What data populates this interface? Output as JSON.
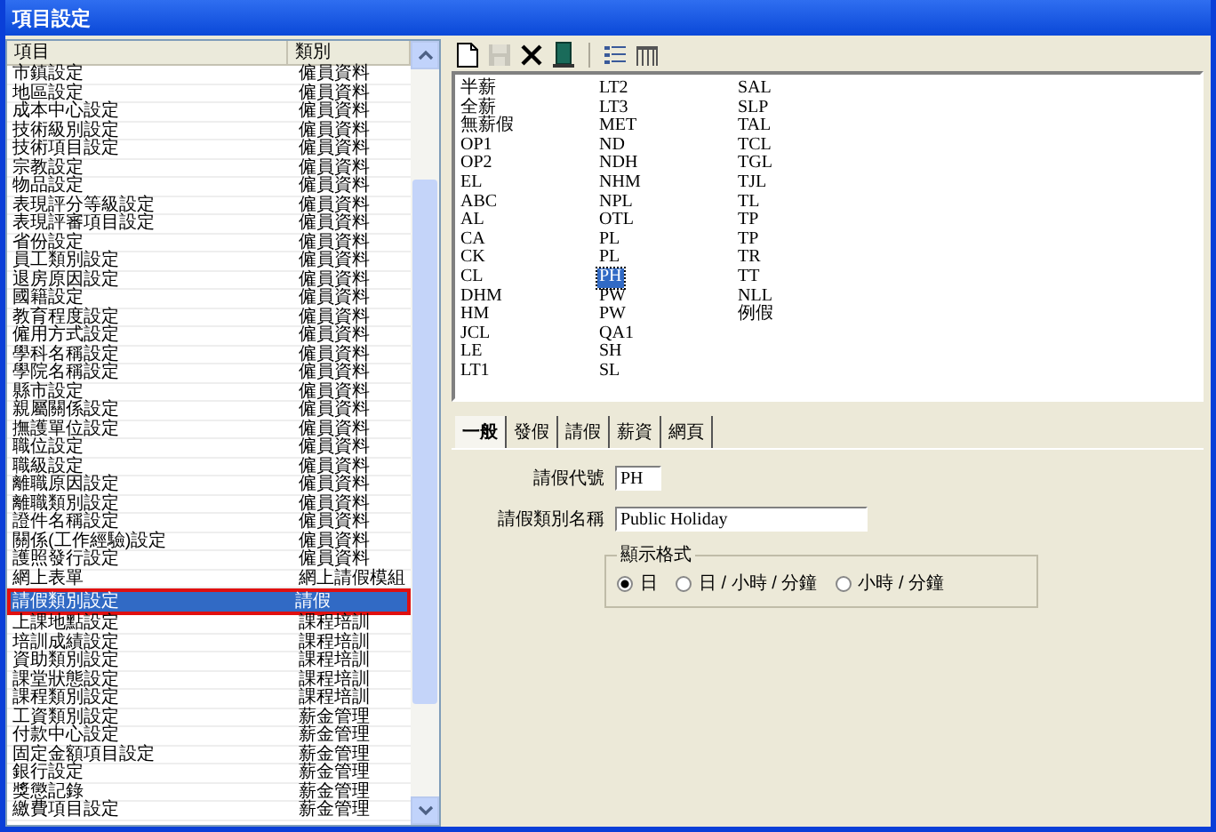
{
  "window": {
    "title": "項目設定"
  },
  "list": {
    "columns": [
      "項目",
      "類別"
    ],
    "rows": [
      {
        "item": "市鎮設定",
        "category": "僱員資料",
        "selected": false,
        "marked": false
      },
      {
        "item": "地區設定",
        "category": "僱員資料",
        "selected": false,
        "marked": false
      },
      {
        "item": "成本中心設定",
        "category": "僱員資料",
        "selected": false,
        "marked": false
      },
      {
        "item": "技術級別設定",
        "category": "僱員資料",
        "selected": false,
        "marked": false
      },
      {
        "item": "技術項目設定",
        "category": "僱員資料",
        "selected": false,
        "marked": false
      },
      {
        "item": "宗教設定",
        "category": "僱員資料",
        "selected": false,
        "marked": false
      },
      {
        "item": "物品設定",
        "category": "僱員資料",
        "selected": false,
        "marked": false
      },
      {
        "item": "表現評分等級設定",
        "category": "僱員資料",
        "selected": false,
        "marked": false
      },
      {
        "item": "表現評審項目設定",
        "category": "僱員資料",
        "selected": false,
        "marked": false
      },
      {
        "item": "省份設定",
        "category": "僱員資料",
        "selected": false,
        "marked": false
      },
      {
        "item": "員工類別設定",
        "category": "僱員資料",
        "selected": false,
        "marked": false
      },
      {
        "item": "退房原因設定",
        "category": "僱員資料",
        "selected": false,
        "marked": false
      },
      {
        "item": "國籍設定",
        "category": "僱員資料",
        "selected": false,
        "marked": false
      },
      {
        "item": "教育程度設定",
        "category": "僱員資料",
        "selected": false,
        "marked": false
      },
      {
        "item": "僱用方式設定",
        "category": "僱員資料",
        "selected": false,
        "marked": false
      },
      {
        "item": "學科名稱設定",
        "category": "僱員資料",
        "selected": false,
        "marked": false
      },
      {
        "item": "學院名稱設定",
        "category": "僱員資料",
        "selected": false,
        "marked": false
      },
      {
        "item": "縣市設定",
        "category": "僱員資料",
        "selected": false,
        "marked": false
      },
      {
        "item": "親屬關係設定",
        "category": "僱員資料",
        "selected": false,
        "marked": false
      },
      {
        "item": "撫護單位設定",
        "category": "僱員資料",
        "selected": false,
        "marked": false
      },
      {
        "item": "職位設定",
        "category": "僱員資料",
        "selected": false,
        "marked": false
      },
      {
        "item": "職級設定",
        "category": "僱員資料",
        "selected": false,
        "marked": false
      },
      {
        "item": "離職原因設定",
        "category": "僱員資料",
        "selected": false,
        "marked": false
      },
      {
        "item": "離職類別設定",
        "category": "僱員資料",
        "selected": false,
        "marked": false
      },
      {
        "item": "證件名稱設定",
        "category": "僱員資料",
        "selected": false,
        "marked": false
      },
      {
        "item": "關係(工作經驗)設定",
        "category": "僱員資料",
        "selected": false,
        "marked": false
      },
      {
        "item": "護照發行設定",
        "category": "僱員資料",
        "selected": false,
        "marked": false
      },
      {
        "item": "網上表單",
        "category": "網上請假模組",
        "selected": false,
        "marked": false
      },
      {
        "item": "請假類別設定",
        "category": "請假",
        "selected": true,
        "marked": true
      },
      {
        "item": "上課地點設定",
        "category": "課程培訓",
        "selected": false,
        "marked": false
      },
      {
        "item": "培訓成績設定",
        "category": "課程培訓",
        "selected": false,
        "marked": false
      },
      {
        "item": "資助類別設定",
        "category": "課程培訓",
        "selected": false,
        "marked": false
      },
      {
        "item": "課堂狀態設定",
        "category": "課程培訓",
        "selected": false,
        "marked": false
      },
      {
        "item": "課程類別設定",
        "category": "課程培訓",
        "selected": false,
        "marked": false
      },
      {
        "item": "工資類別設定",
        "category": "薪金管理",
        "selected": false,
        "marked": false
      },
      {
        "item": "付款中心設定",
        "category": "薪金管理",
        "selected": false,
        "marked": false
      },
      {
        "item": "固定金額項目設定",
        "category": "薪金管理",
        "selected": false,
        "marked": false
      },
      {
        "item": "銀行設定",
        "category": "薪金管理",
        "selected": false,
        "marked": false
      },
      {
        "item": "獎懲記錄",
        "category": "薪金管理",
        "selected": false,
        "marked": false
      },
      {
        "item": "繳費項目設定",
        "category": "薪金管理",
        "selected": false,
        "marked": false
      }
    ]
  },
  "toolbar": [
    {
      "kind": "new",
      "disabled": false
    },
    {
      "kind": "save",
      "disabled": true
    },
    {
      "kind": "delete",
      "disabled": false
    },
    {
      "kind": "exit",
      "disabled": false
    },
    {
      "kind": "sep"
    },
    {
      "kind": "list",
      "disabled": false
    },
    {
      "kind": "columns",
      "disabled": false
    }
  ],
  "codes": [
    {
      "text": "半薪",
      "selected": false
    },
    {
      "text": "全薪",
      "selected": false
    },
    {
      "text": "無薪假",
      "selected": false
    },
    {
      "text": "OP1",
      "selected": false
    },
    {
      "text": "OP2",
      "selected": false
    },
    {
      "text": "EL",
      "selected": false
    },
    {
      "text": "ABC",
      "selected": false
    },
    {
      "text": "AL",
      "selected": false
    },
    {
      "text": "CA",
      "selected": false
    },
    {
      "text": "CK",
      "selected": false
    },
    {
      "text": "CL",
      "selected": false
    },
    {
      "text": "DHM",
      "selected": false
    },
    {
      "text": "HM",
      "selected": false
    },
    {
      "text": "JCL",
      "selected": false
    },
    {
      "text": "LE",
      "selected": false
    },
    {
      "text": "LT1",
      "selected": false
    },
    {
      "text": "LT2",
      "selected": false
    },
    {
      "text": "LT3",
      "selected": false
    },
    {
      "text": "MET",
      "selected": false
    },
    {
      "text": "ND",
      "selected": false
    },
    {
      "text": "NDH",
      "selected": false
    },
    {
      "text": "NHM",
      "selected": false
    },
    {
      "text": "NPL",
      "selected": false
    },
    {
      "text": "OTL",
      "selected": false
    },
    {
      "text": "PL",
      "selected": false
    },
    {
      "text": "PL",
      "selected": false
    },
    {
      "text": "PH",
      "selected": true
    },
    {
      "text": "PW",
      "selected": false
    },
    {
      "text": "PW",
      "selected": false
    },
    {
      "text": "QA1",
      "selected": false
    },
    {
      "text": "SH",
      "selected": false
    },
    {
      "text": "SL",
      "selected": false
    },
    {
      "text": "SAL",
      "selected": false
    },
    {
      "text": "SLP",
      "selected": false
    },
    {
      "text": "TAL",
      "selected": false
    },
    {
      "text": "TCL",
      "selected": false
    },
    {
      "text": "TGL",
      "selected": false
    },
    {
      "text": "TJL",
      "selected": false
    },
    {
      "text": "TL",
      "selected": false
    },
    {
      "text": "TP",
      "selected": false
    },
    {
      "text": "TP",
      "selected": false
    },
    {
      "text": "TR",
      "selected": false
    },
    {
      "text": "TT",
      "selected": false
    },
    {
      "text": "NLL",
      "selected": false
    },
    {
      "text": "例假",
      "selected": false
    }
  ],
  "tabs": [
    {
      "label": "一般",
      "selected": true
    },
    {
      "label": "發假",
      "selected": false
    },
    {
      "label": "請假",
      "selected": false
    },
    {
      "label": "薪資",
      "selected": false
    },
    {
      "label": "網頁",
      "selected": false
    }
  ],
  "form": {
    "code": {
      "label": "請假代號",
      "value": "PH"
    },
    "name": {
      "label": "請假類別名稱",
      "value": "Public Holiday"
    },
    "display_format": {
      "label": "顯示格式",
      "options": [
        {
          "label": "日",
          "selected": true
        },
        {
          "label": "日 / 小時 / 分鐘",
          "selected": false
        },
        {
          "label": "小時 / 分鐘",
          "selected": false
        }
      ]
    }
  }
}
